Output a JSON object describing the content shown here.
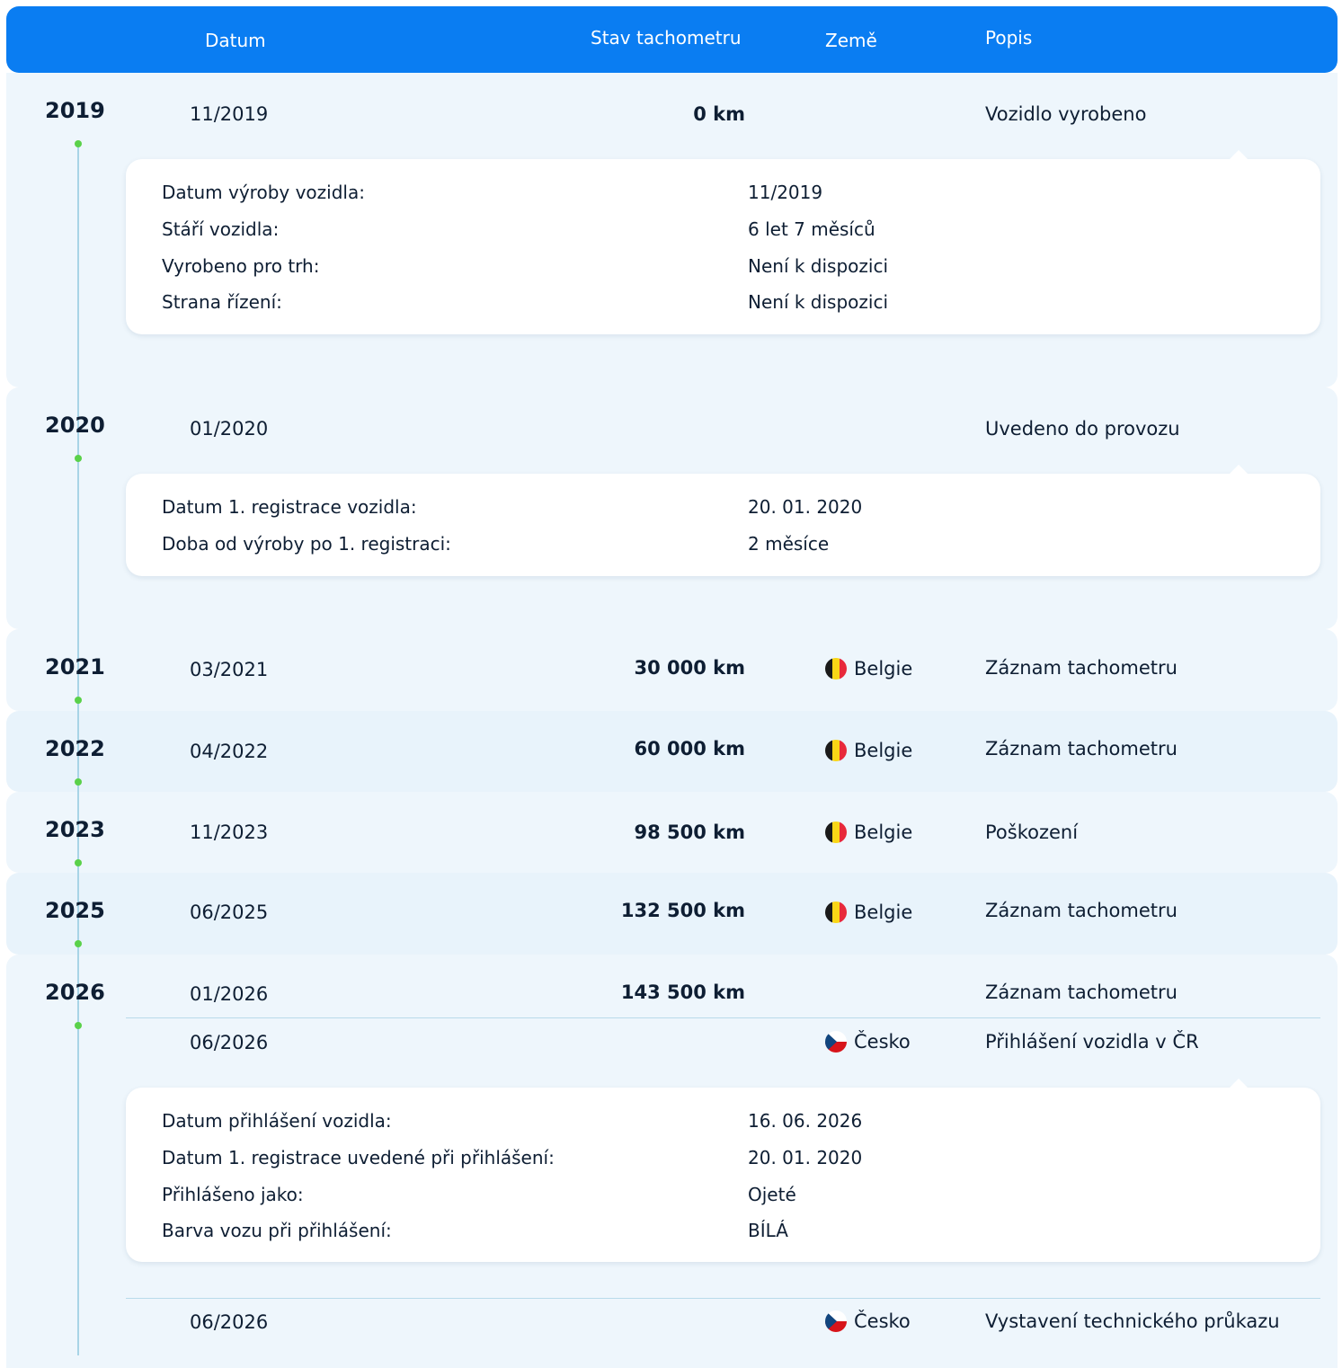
{
  "header": {
    "datum": "Datum",
    "stav": "Stav tachometru",
    "zeme": "Země",
    "popis": "Popis"
  },
  "sections": {
    "y2019": {
      "year": "2019",
      "date": "11/2019",
      "km": "0 km",
      "desc": "Vozidlo vyrobeno",
      "details": [
        {
          "label": "Datum výroby vozidla:",
          "value": "11/2019"
        },
        {
          "label": "Stáří vozidla:",
          "value": "6 let 7 měsíců"
        },
        {
          "label": "Vyrobeno pro trh:",
          "value": "Není k dispozici"
        },
        {
          "label": "Strana řízení:",
          "value": "Není k dispozici"
        }
      ]
    },
    "y2020": {
      "year": "2020",
      "date": "01/2020",
      "desc": "Uvedeno do provozu",
      "details": [
        {
          "label": "Datum 1. registrace vozidla:",
          "value": "20. 01. 2020"
        },
        {
          "label": "Doba od výroby po 1. registraci:",
          "value": "2 měsíce"
        }
      ]
    },
    "y2021": {
      "year": "2021",
      "date": "03/2021",
      "km": "30 000 km",
      "country": "Belgie",
      "desc": "Záznam tachometru"
    },
    "y2022": {
      "year": "2022",
      "date": "04/2022",
      "km": "60 000 km",
      "country": "Belgie",
      "desc": "Záznam tachometru"
    },
    "y2023": {
      "year": "2023",
      "date": "11/2023",
      "km": "98 500 km",
      "country": "Belgie",
      "desc": "Poškození"
    },
    "y2025": {
      "year": "2025",
      "date": "06/2025",
      "km": "132 500 km",
      "country": "Belgie",
      "desc": "Záznam tachometru"
    },
    "y2026": {
      "year": "2026",
      "rows": [
        {
          "date": "01/2026",
          "km": "143 500 km",
          "desc": "Záznam tachometru"
        },
        {
          "date": "06/2026",
          "country": "Česko",
          "desc": "Přihlášení vozidla v ČR"
        },
        {
          "date": "06/2026",
          "country": "Česko",
          "desc": "Vystavení technického průkazu"
        }
      ],
      "details": [
        {
          "label": "Datum přihlášení vozidla:",
          "value": "16. 06. 2026"
        },
        {
          "label": "Datum 1. registrace uvedené při přihlášení:",
          "value": "20. 01. 2020"
        },
        {
          "label": "Přihlášeno jako:",
          "value": "Ojeté"
        },
        {
          "label": "Barva vozu při přihlášení:",
          "value": "BÍLÁ"
        }
      ]
    }
  },
  "colors": {
    "header_bg": "#0a7df2",
    "section_bg": "#eef6fc",
    "timeline_dot": "#5ad14a",
    "timeline_line": "#a8d4e6"
  }
}
